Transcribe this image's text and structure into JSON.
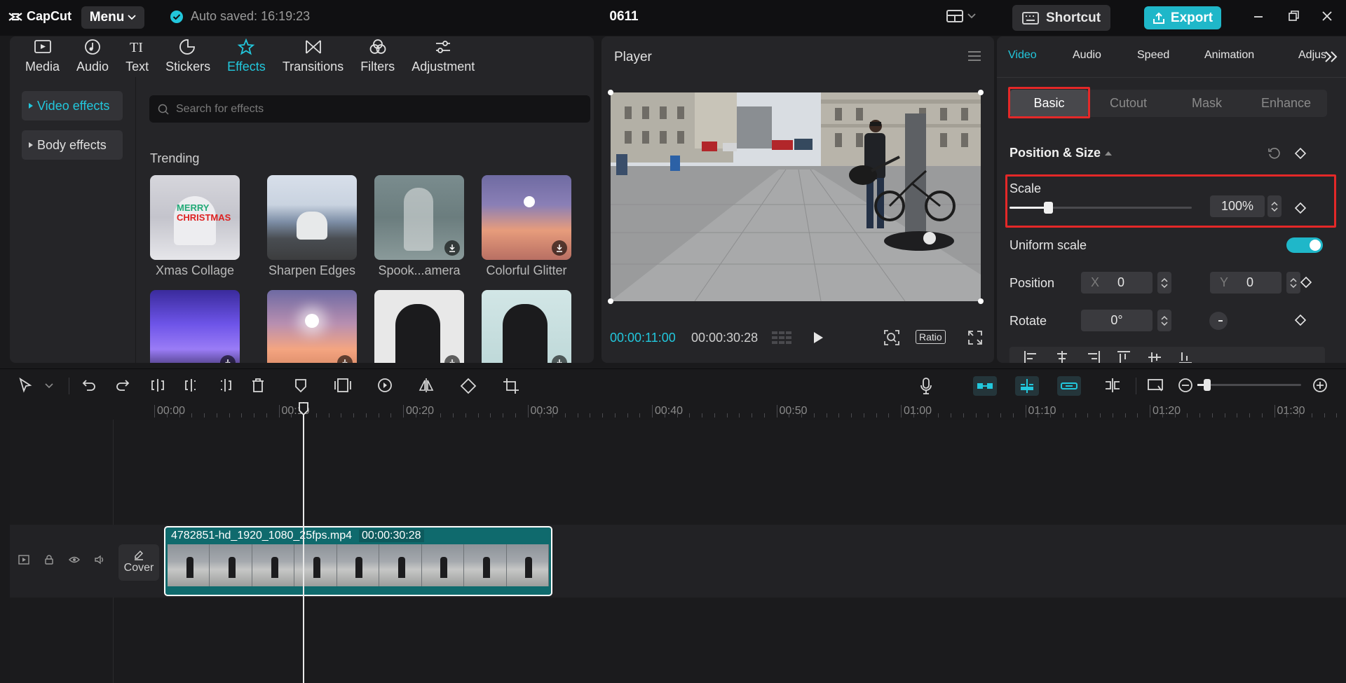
{
  "app": {
    "brand": "CapCut",
    "menu_label": "Menu",
    "autosave": "Auto saved: 16:19:23",
    "project": "0611",
    "shortcut_label": "Shortcut",
    "export_label": "Export",
    "accent": "#22c7dc"
  },
  "media_tabs": [
    {
      "label": "Media",
      "icon": "media-icon"
    },
    {
      "label": "Audio",
      "icon": "audio-icon"
    },
    {
      "label": "Text",
      "icon": "text-icon"
    },
    {
      "label": "Stickers",
      "icon": "stickers-icon"
    },
    {
      "label": "Effects",
      "icon": "effects-icon",
      "active": true
    },
    {
      "label": "Transitions",
      "icon": "transitions-icon"
    },
    {
      "label": "Filters",
      "icon": "filters-icon"
    },
    {
      "label": "Adjustment",
      "icon": "adjustment-icon"
    }
  ],
  "effects_nav": {
    "video": "Video effects",
    "body": "Body effects"
  },
  "search": {
    "placeholder": "Search for effects"
  },
  "trending": {
    "title": "Trending",
    "items": [
      {
        "label": "Xmas Collage"
      },
      {
        "label": "Sharpen Edges"
      },
      {
        "label": "Spook...amera"
      },
      {
        "label": "Colorful Glitter"
      }
    ]
  },
  "player": {
    "title": "Player",
    "current_time": "00:00:11:00",
    "total_time": "00:00:30:28",
    "ratio_label": "Ratio"
  },
  "inspector": {
    "tabs": [
      "Video",
      "Audio",
      "Speed",
      "Animation",
      "Adjus"
    ],
    "subtabs": [
      "Basic",
      "Cutout",
      "Mask",
      "Enhance"
    ],
    "section": "Position & Size",
    "scale_label": "Scale",
    "scale_value": "100%",
    "scale_fraction": 0.21,
    "uniform_label": "Uniform scale",
    "uniform_on": true,
    "position_label": "Position",
    "x_label": "X",
    "x_value": "0",
    "y_label": "Y",
    "y_value": "0",
    "rotate_label": "Rotate",
    "rotate_value": "0°"
  },
  "timeline": {
    "ticks": [
      "00:00",
      "00:10",
      "00:20",
      "00:30",
      "00:40",
      "00:50",
      "01:00",
      "01:10",
      "01:20",
      "01:30"
    ],
    "clip_name": "4782851-hd_1920_1080_25fps.mp4",
    "clip_duration": "00:00:30:28",
    "cover_label": "Cover",
    "zoom_fraction": 0.06
  }
}
